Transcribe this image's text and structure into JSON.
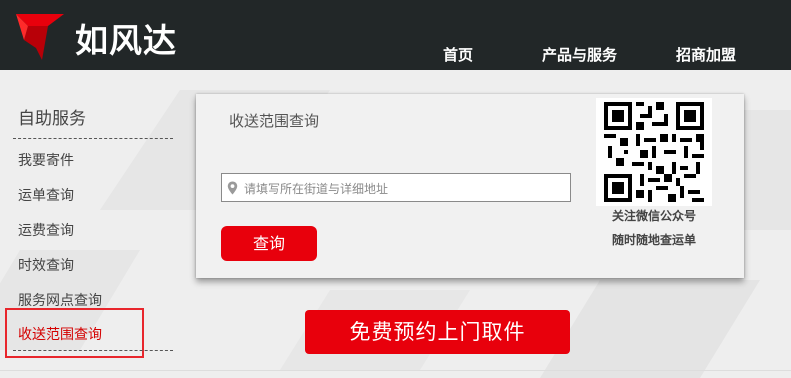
{
  "brand": {
    "name": "如风达"
  },
  "nav": {
    "items": [
      {
        "label": "首页"
      },
      {
        "label": "产品与服务"
      },
      {
        "label": "招商加盟"
      }
    ]
  },
  "sidebar": {
    "title": "自助服务",
    "items": [
      {
        "label": "我要寄件"
      },
      {
        "label": "运单查询"
      },
      {
        "label": "运费查询"
      },
      {
        "label": "时效查询"
      },
      {
        "label": "服务网点查询"
      },
      {
        "label": "收送范围查询"
      }
    ],
    "active_index": 5
  },
  "panel": {
    "title": "收送范围查询",
    "address_input": {
      "placeholder": "请填写所在街道与详细地址",
      "value": ""
    },
    "query_button": "查询",
    "qr_caption_line1": "关注微信公众号",
    "qr_caption_line2": "随时随地查运单"
  },
  "cta": {
    "label": "免费预约上门取件"
  },
  "colors": {
    "accent": "#e8000c",
    "header_bg": "#222728",
    "active_text": "#d40000"
  }
}
